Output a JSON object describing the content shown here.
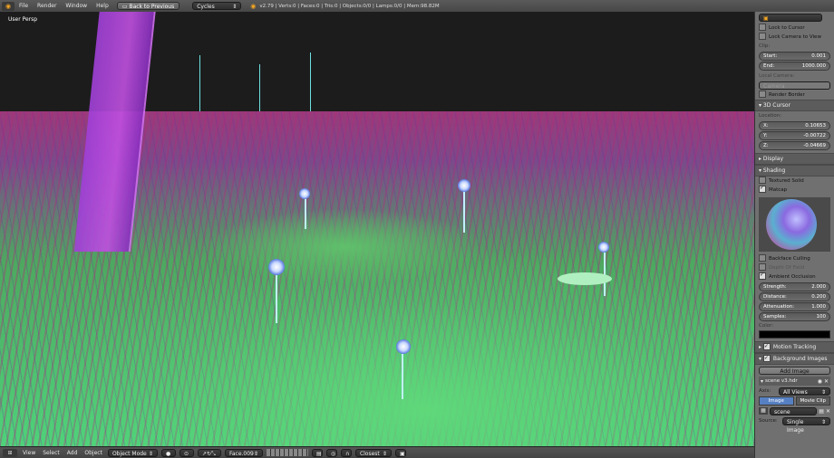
{
  "topbar": {
    "menus": [
      "File",
      "Render",
      "Window",
      "Help"
    ],
    "back_button": "Back to Previous",
    "engine": "Cycles Render",
    "stats": "v2.79 | Verts:0 | Faces:0 | Tris:0 | Objects:0/0 | Lamps:0/0 | Mem:98.82M"
  },
  "viewport": {
    "label": "User Persp"
  },
  "bottombar": {
    "menus": [
      "View",
      "Select",
      "Add",
      "Object"
    ],
    "mode": "Object Mode",
    "object_field": "Face.009",
    "snap_target": "Closest"
  },
  "panel": {
    "lock_to_cursor": "Lock to Cursor",
    "lock_camera": "Lock Camera to View",
    "clip": "Clip:",
    "start_label": "Start:",
    "start_value": "0.001",
    "end_label": "End:",
    "end_value": "1000.000",
    "local_camera": "Local Camera:",
    "camera_field": "Camera",
    "render_border": "Render Border",
    "cursor_header": "3D Cursor",
    "location": "Location:",
    "x_label": "X:",
    "x_value": "0.10653",
    "y_label": "Y:",
    "y_value": "-0.00722",
    "z_label": "Z:",
    "z_value": "-0.04669",
    "display_header": "Display",
    "shading_header": "Shading",
    "textured_solid": "Textured Solid",
    "matcap": "Matcap",
    "backface": "Backface Culling",
    "depth_of_field": "Depth Of Field",
    "ao": "Ambient Occlusion",
    "strength_label": "Strength:",
    "strength_value": "2.000",
    "distance_label": "Distance:",
    "distance_value": "0.200",
    "attenuation_label": "Attenuation:",
    "attenuation_value": "1.000",
    "samples_label": "Samples:",
    "samples_value": "100",
    "color_label": "Color:",
    "motion_tracking": "Motion Tracking",
    "background_images": "Background Images",
    "add_image": "Add Image",
    "image_name": "scene v3.hdr",
    "axis_label": "Axis:",
    "axis_value": "All Views",
    "tab_image": "Image",
    "tab_movie": "Movie Clip",
    "image_field": "scene",
    "source_label": "Source:",
    "source_value": "Single Image"
  },
  "colors": {
    "accent": "#5680c2",
    "pillar": "#b048e0",
    "ground": "#4ed27a"
  }
}
